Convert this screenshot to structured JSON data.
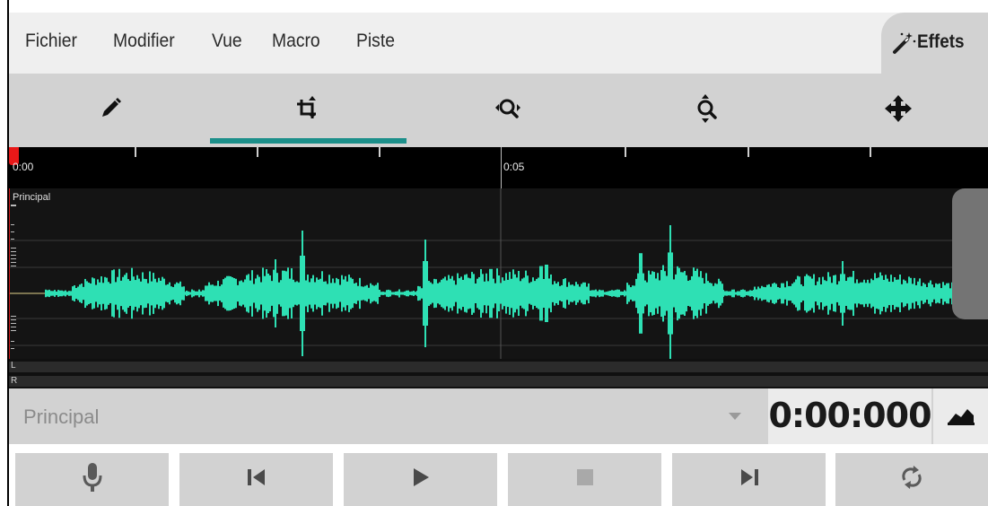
{
  "menu": {
    "items": [
      "Fichier",
      "Modifier",
      "Vue",
      "Macro",
      "Piste"
    ],
    "effects_label": "Effets"
  },
  "toolbar": {
    "tools": [
      "pencil-icon",
      "crop-icon",
      "zoom-horizontal-icon",
      "zoom-vertical-icon",
      "move-icon"
    ],
    "active_index": 1,
    "accent_color": "#1c8f8a"
  },
  "ruler": {
    "labels": [
      "0:00",
      "0:05"
    ]
  },
  "track": {
    "name_label": "Principal",
    "channels": [
      "L",
      "R"
    ],
    "waveform_color": "#2ee0b4"
  },
  "bottom": {
    "track_select_value": "Principal",
    "time": "0:00:000"
  },
  "transport": {
    "buttons": [
      "microphone-icon",
      "skip-back-icon",
      "play-icon",
      "stop-icon",
      "skip-forward-icon",
      "loop-icon"
    ]
  }
}
